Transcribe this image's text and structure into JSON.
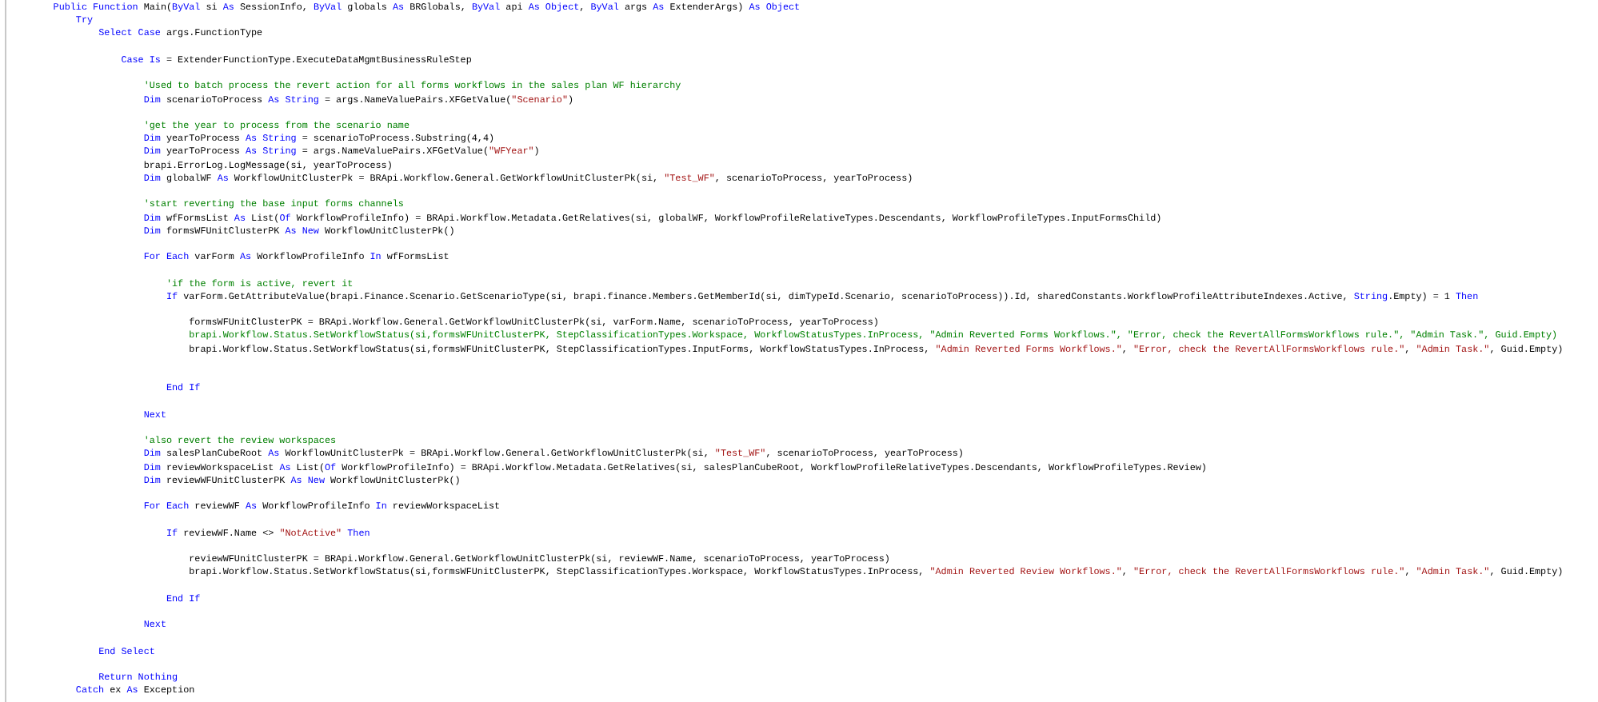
{
  "editor": {
    "lines": [
      {
        "kind": "code",
        "tokens": [
          {
            "kind": "keyword",
            "text": "        Public Function"
          },
          {
            "kind": "plain",
            "text": " Main("
          },
          {
            "kind": "keyword",
            "text": "ByVal"
          },
          {
            "kind": "plain",
            "text": " si "
          },
          {
            "kind": "keyword",
            "text": "As"
          },
          {
            "kind": "plain",
            "text": " SessionInfo, "
          },
          {
            "kind": "keyword",
            "text": "ByVal"
          },
          {
            "kind": "plain",
            "text": " globals "
          },
          {
            "kind": "keyword",
            "text": "As"
          },
          {
            "kind": "plain",
            "text": " BRGlobals, "
          },
          {
            "kind": "keyword",
            "text": "ByVal"
          },
          {
            "kind": "plain",
            "text": " api "
          },
          {
            "kind": "keyword",
            "text": "As Object"
          },
          {
            "kind": "plain",
            "text": ", "
          },
          {
            "kind": "keyword",
            "text": "ByVal"
          },
          {
            "kind": "plain",
            "text": " args "
          },
          {
            "kind": "keyword",
            "text": "As"
          },
          {
            "kind": "plain",
            "text": " ExtenderArgs) "
          },
          {
            "kind": "keyword",
            "text": "As Object"
          }
        ]
      },
      {
        "kind": "code",
        "tokens": [
          {
            "kind": "keyword",
            "text": "            Try"
          }
        ]
      },
      {
        "kind": "code",
        "tokens": [
          {
            "kind": "keyword",
            "text": "                Select Case"
          },
          {
            "kind": "plain",
            "text": " args.FunctionType"
          }
        ]
      },
      {
        "kind": "blank"
      },
      {
        "kind": "code",
        "tokens": [
          {
            "kind": "keyword",
            "text": "                    Case Is"
          },
          {
            "kind": "plain",
            "text": " = ExtenderFunctionType.ExecuteDataMgmtBusinessRuleStep"
          }
        ]
      },
      {
        "kind": "blank"
      },
      {
        "kind": "code",
        "tokens": [
          {
            "kind": "comment",
            "text": "                        'Used to batch process the revert action for all forms workflows in the sales plan WF hierarchy"
          }
        ]
      },
      {
        "kind": "code",
        "tokens": [
          {
            "kind": "keyword",
            "text": "                        Dim"
          },
          {
            "kind": "plain",
            "text": " scenarioToProcess "
          },
          {
            "kind": "keyword",
            "text": "As String"
          },
          {
            "kind": "plain",
            "text": " = args.NameValuePairs.XFGetValue("
          },
          {
            "kind": "string",
            "text": "\"Scenario\""
          },
          {
            "kind": "plain",
            "text": ")"
          }
        ]
      },
      {
        "kind": "blank"
      },
      {
        "kind": "code",
        "tokens": [
          {
            "kind": "comment",
            "text": "                        'get the year to process from the scenario name"
          }
        ]
      },
      {
        "kind": "code",
        "tokens": [
          {
            "kind": "keyword",
            "text": "                        Dim"
          },
          {
            "kind": "plain",
            "text": " yearToProcess "
          },
          {
            "kind": "keyword",
            "text": "As String"
          },
          {
            "kind": "plain",
            "text": " = scenarioToProcess.Substring(4,4)"
          }
        ]
      },
      {
        "kind": "code",
        "tokens": [
          {
            "kind": "keyword",
            "text": "                        Dim"
          },
          {
            "kind": "plain",
            "text": " yearToProcess "
          },
          {
            "kind": "keyword",
            "text": "As String"
          },
          {
            "kind": "plain",
            "text": " = args.NameValuePairs.XFGetValue("
          },
          {
            "kind": "string",
            "text": "\"WFYear\""
          },
          {
            "kind": "plain",
            "text": ")"
          }
        ]
      },
      {
        "kind": "code",
        "tokens": [
          {
            "kind": "plain",
            "text": "                        brapi.ErrorLog.LogMessage(si, yearToProcess)"
          }
        ]
      },
      {
        "kind": "code",
        "tokens": [
          {
            "kind": "keyword",
            "text": "                        Dim"
          },
          {
            "kind": "plain",
            "text": " globalWF "
          },
          {
            "kind": "keyword",
            "text": "As"
          },
          {
            "kind": "plain",
            "text": " WorkflowUnitClusterPk = BRApi.Workflow.General.GetWorkflowUnitClusterPk(si, "
          },
          {
            "kind": "string",
            "text": "\"Test_WF\""
          },
          {
            "kind": "plain",
            "text": ", scenarioToProcess, yearToProcess)"
          }
        ]
      },
      {
        "kind": "blank"
      },
      {
        "kind": "code",
        "tokens": [
          {
            "kind": "comment",
            "text": "                        'start reverting the base input forms channels"
          }
        ]
      },
      {
        "kind": "code",
        "tokens": [
          {
            "kind": "keyword",
            "text": "                        Dim"
          },
          {
            "kind": "plain",
            "text": " wfFormsList "
          },
          {
            "kind": "keyword",
            "text": "As"
          },
          {
            "kind": "plain",
            "text": " List("
          },
          {
            "kind": "keyword",
            "text": "Of"
          },
          {
            "kind": "plain",
            "text": " WorkflowProfileInfo) = BRApi.Workflow.Metadata.GetRelatives(si, globalWF, WorkflowProfileRelativeTypes.Descendants, WorkflowProfileTypes.InputFormsChild)"
          }
        ]
      },
      {
        "kind": "code",
        "tokens": [
          {
            "kind": "keyword",
            "text": "                        Dim"
          },
          {
            "kind": "plain",
            "text": " formsWFUnitClusterPK "
          },
          {
            "kind": "keyword",
            "text": "As New"
          },
          {
            "kind": "plain",
            "text": " WorkflowUnitClusterPk()"
          }
        ]
      },
      {
        "kind": "blank"
      },
      {
        "kind": "code",
        "tokens": [
          {
            "kind": "keyword",
            "text": "                        For Each"
          },
          {
            "kind": "plain",
            "text": " varForm "
          },
          {
            "kind": "keyword",
            "text": "As"
          },
          {
            "kind": "plain",
            "text": " WorkflowProfileInfo "
          },
          {
            "kind": "keyword",
            "text": "In"
          },
          {
            "kind": "plain",
            "text": " wfFormsList"
          }
        ]
      },
      {
        "kind": "blank"
      },
      {
        "kind": "code",
        "tokens": [
          {
            "kind": "comment",
            "text": "                            'if the form is active, revert it"
          }
        ]
      },
      {
        "kind": "code",
        "tokens": [
          {
            "kind": "keyword",
            "text": "                            If"
          },
          {
            "kind": "plain",
            "text": " varForm.GetAttributeValue(brapi.Finance.Scenario.GetScenarioType(si, brapi.finance.Members.GetMemberId(si, dimTypeId.Scenario, scenarioToProcess)).Id, sharedConstants.WorkflowProfileAttributeIndexes.Active, "
          },
          {
            "kind": "keyword",
            "text": "String"
          },
          {
            "kind": "plain",
            "text": ".Empty) = 1 "
          },
          {
            "kind": "keyword",
            "text": "Then"
          }
        ]
      },
      {
        "kind": "blank"
      },
      {
        "kind": "code",
        "tokens": [
          {
            "kind": "plain",
            "text": "                                formsWFUnitClusterPK = BRApi.Workflow.General.GetWorkflowUnitClusterPk(si, varForm.Name, scenarioToProcess, yearToProcess)"
          }
        ]
      },
      {
        "kind": "code",
        "tokens": [
          {
            "kind": "comment",
            "text": "                                brapi.Workflow.Status.SetWorkflowStatus(si,formsWFUnitClusterPK, StepClassificationTypes.Workspace, WorkflowStatusTypes.InProcess, \"Admin Reverted Forms Workflows.\", \"Error, check the RevertAllFormsWorkflows rule.\", \"Admin Task.\", Guid.Empty)"
          }
        ]
      },
      {
        "kind": "code",
        "tokens": [
          {
            "kind": "plain",
            "text": "                                brapi.Workflow.Status.SetWorkflowStatus(si,formsWFUnitClusterPK, StepClassificationTypes.InputForms, WorkflowStatusTypes.InProcess, "
          },
          {
            "kind": "string",
            "text": "\"Admin Reverted Forms Workflows.\""
          },
          {
            "kind": "plain",
            "text": ", "
          },
          {
            "kind": "string",
            "text": "\"Error, check the RevertAllFormsWorkflows rule.\""
          },
          {
            "kind": "plain",
            "text": ", "
          },
          {
            "kind": "string",
            "text": "\"Admin Task.\""
          },
          {
            "kind": "plain",
            "text": ", Guid.Empty)"
          }
        ]
      },
      {
        "kind": "blank"
      },
      {
        "kind": "blank"
      },
      {
        "kind": "code",
        "tokens": [
          {
            "kind": "keyword",
            "text": "                            End If"
          }
        ]
      },
      {
        "kind": "blank"
      },
      {
        "kind": "code",
        "tokens": [
          {
            "kind": "keyword",
            "text": "                        Next"
          }
        ]
      },
      {
        "kind": "blank"
      },
      {
        "kind": "code",
        "tokens": [
          {
            "kind": "comment",
            "text": "                        'also revert the review workspaces"
          }
        ]
      },
      {
        "kind": "code",
        "tokens": [
          {
            "kind": "keyword",
            "text": "                        Dim"
          },
          {
            "kind": "plain",
            "text": " salesPlanCubeRoot "
          },
          {
            "kind": "keyword",
            "text": "As"
          },
          {
            "kind": "plain",
            "text": " WorkflowUnitClusterPk = BRApi.Workflow.General.GetWorkflowUnitClusterPk(si, "
          },
          {
            "kind": "string",
            "text": "\"Test_WF\""
          },
          {
            "kind": "plain",
            "text": ", scenarioToProcess, yearToProcess)"
          }
        ]
      },
      {
        "kind": "code",
        "tokens": [
          {
            "kind": "keyword",
            "text": "                        Dim"
          },
          {
            "kind": "plain",
            "text": " reviewWorkspaceList "
          },
          {
            "kind": "keyword",
            "text": "As"
          },
          {
            "kind": "plain",
            "text": " List("
          },
          {
            "kind": "keyword",
            "text": "Of"
          },
          {
            "kind": "plain",
            "text": " WorkflowProfileInfo) = BRApi.Workflow.Metadata.GetRelatives(si, salesPlanCubeRoot, WorkflowProfileRelativeTypes.Descendants, WorkflowProfileTypes.Review)"
          }
        ]
      },
      {
        "kind": "code",
        "tokens": [
          {
            "kind": "keyword",
            "text": "                        Dim"
          },
          {
            "kind": "plain",
            "text": " reviewWFUnitClusterPK "
          },
          {
            "kind": "keyword",
            "text": "As New"
          },
          {
            "kind": "plain",
            "text": " WorkflowUnitClusterPk()"
          }
        ]
      },
      {
        "kind": "blank"
      },
      {
        "kind": "code",
        "tokens": [
          {
            "kind": "keyword",
            "text": "                        For Each"
          },
          {
            "kind": "plain",
            "text": " reviewWF "
          },
          {
            "kind": "keyword",
            "text": "As"
          },
          {
            "kind": "plain",
            "text": " WorkflowProfileInfo "
          },
          {
            "kind": "keyword",
            "text": "In"
          },
          {
            "kind": "plain",
            "text": " reviewWorkspaceList"
          }
        ]
      },
      {
        "kind": "blank"
      },
      {
        "kind": "code",
        "tokens": [
          {
            "kind": "keyword",
            "text": "                            If"
          },
          {
            "kind": "plain",
            "text": " reviewWF.Name <> "
          },
          {
            "kind": "string",
            "text": "\"NotActive\""
          },
          {
            "kind": "keyword",
            "text": " Then"
          }
        ]
      },
      {
        "kind": "blank"
      },
      {
        "kind": "code",
        "tokens": [
          {
            "kind": "plain",
            "text": "                                reviewWFUnitClusterPK = BRApi.Workflow.General.GetWorkflowUnitClusterPk(si, reviewWF.Name, scenarioToProcess, yearToProcess)"
          }
        ]
      },
      {
        "kind": "code",
        "tokens": [
          {
            "kind": "plain",
            "text": "                                brapi.Workflow.Status.SetWorkflowStatus(si,formsWFUnitClusterPK, StepClassificationTypes.Workspace, WorkflowStatusTypes.InProcess, "
          },
          {
            "kind": "string",
            "text": "\"Admin Reverted Review Workflows.\""
          },
          {
            "kind": "plain",
            "text": ", "
          },
          {
            "kind": "string",
            "text": "\"Error, check the RevertAllFormsWorkflows rule.\""
          },
          {
            "kind": "plain",
            "text": ", "
          },
          {
            "kind": "string",
            "text": "\"Admin Task.\""
          },
          {
            "kind": "plain",
            "text": ", Guid.Empty)"
          }
        ]
      },
      {
        "kind": "blank"
      },
      {
        "kind": "code",
        "tokens": [
          {
            "kind": "keyword",
            "text": "                            End If"
          }
        ]
      },
      {
        "kind": "blank"
      },
      {
        "kind": "code",
        "tokens": [
          {
            "kind": "keyword",
            "text": "                        Next"
          }
        ]
      },
      {
        "kind": "blank"
      },
      {
        "kind": "code",
        "tokens": [
          {
            "kind": "keyword",
            "text": "                End Select"
          }
        ]
      },
      {
        "kind": "blank"
      },
      {
        "kind": "code",
        "tokens": [
          {
            "kind": "keyword",
            "text": "                Return Nothing"
          }
        ]
      },
      {
        "kind": "code",
        "tokens": [
          {
            "kind": "keyword",
            "text": "            Catch"
          },
          {
            "kind": "plain",
            "text": " ex "
          },
          {
            "kind": "keyword",
            "text": "As"
          },
          {
            "kind": "plain",
            "text": " Exception"
          }
        ]
      }
    ]
  }
}
